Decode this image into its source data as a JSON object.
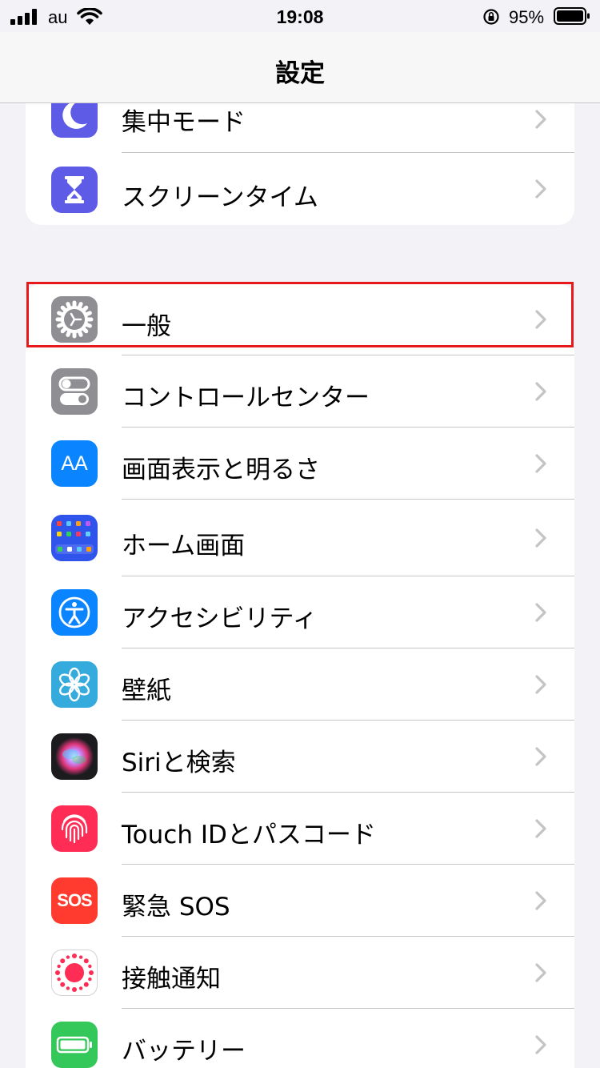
{
  "status_bar": {
    "carrier": "au",
    "time": "19:08",
    "battery_percent": "95%"
  },
  "nav": {
    "title": "設定"
  },
  "colors": {
    "highlight": "#e8191a"
  },
  "group1": [
    {
      "label": "集中モード",
      "icon": "moon-icon",
      "color": "#5e5ce6"
    },
    {
      "label": "スクリーンタイム",
      "icon": "hourglass-icon",
      "color": "#5e5ce6"
    }
  ],
  "group2": [
    {
      "label": "一般",
      "icon": "gear-icon",
      "color": "#8e8e93",
      "highlighted": true
    },
    {
      "label": "コントロールセンター",
      "icon": "toggles-icon",
      "color": "#8e8e93"
    },
    {
      "label": "画面表示と明るさ",
      "icon": "text-size-icon",
      "glyph": "AA",
      "color": "#0a84ff"
    },
    {
      "label": "ホーム画面",
      "icon": "home-screen-icon",
      "color": "#2f54eb"
    },
    {
      "label": "アクセシビリティ",
      "icon": "accessibility-icon",
      "color": "#0a84ff"
    },
    {
      "label": "壁紙",
      "icon": "flower-icon",
      "color": "#35aadc"
    },
    {
      "label": "Siriと検索",
      "icon": "siri-icon",
      "color": "#1c1c1e"
    },
    {
      "label": "Touch IDとパスコード",
      "icon": "fingerprint-icon",
      "color": "#ff2d55"
    },
    {
      "label": "緊急 SOS",
      "icon": "sos-icon",
      "glyph": "SOS",
      "color": "#ff3b30"
    },
    {
      "label": "接触通知",
      "icon": "exposure-icon",
      "color": "#ffffff"
    },
    {
      "label": "バッテリー",
      "icon": "battery-icon",
      "color": "#34c759"
    }
  ]
}
